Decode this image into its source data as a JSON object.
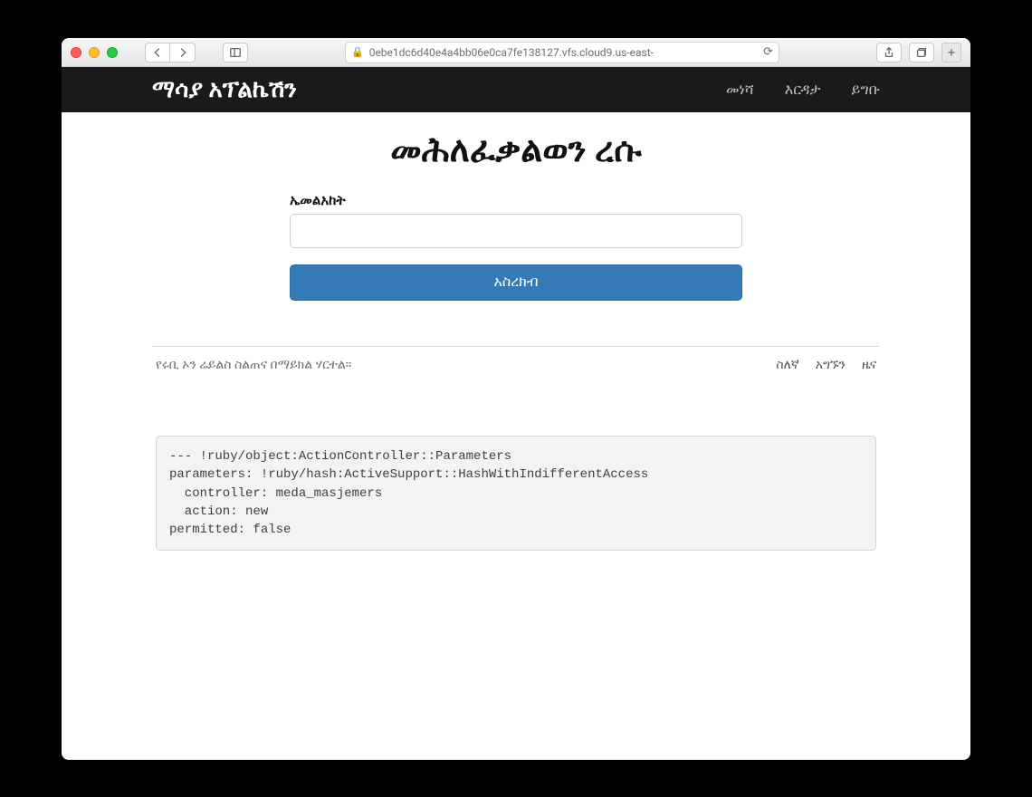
{
  "browser": {
    "url": "0ebe1dc6d40e4a4bb06e0ca7fe138127.vfs.cloud9.us-east-"
  },
  "navbar": {
    "brand": "ማሳያ አፕልኬሽን",
    "links": {
      "home": "መነሻ",
      "help": "እርዳታ",
      "login": "ይግቡ"
    }
  },
  "page_title": "መሕለፈቃልወን ረሱ",
  "form": {
    "email_label": "ኤመልአከት",
    "email_value": "",
    "submit_label": "አስረክብ"
  },
  "footer": {
    "note": "የሩቢ ኦን ሬይልስ ስልጠና በማይክል ሃርተል።",
    "links": {
      "about": "ስለኛ",
      "contact": "አግኙን",
      "news": "ዜና"
    }
  },
  "debug_dump": "--- !ruby/object:ActionController::Parameters\nparameters: !ruby/hash:ActiveSupport::HashWithIndifferentAccess\n  controller: meda_masjemers\n  action: new\npermitted: false"
}
